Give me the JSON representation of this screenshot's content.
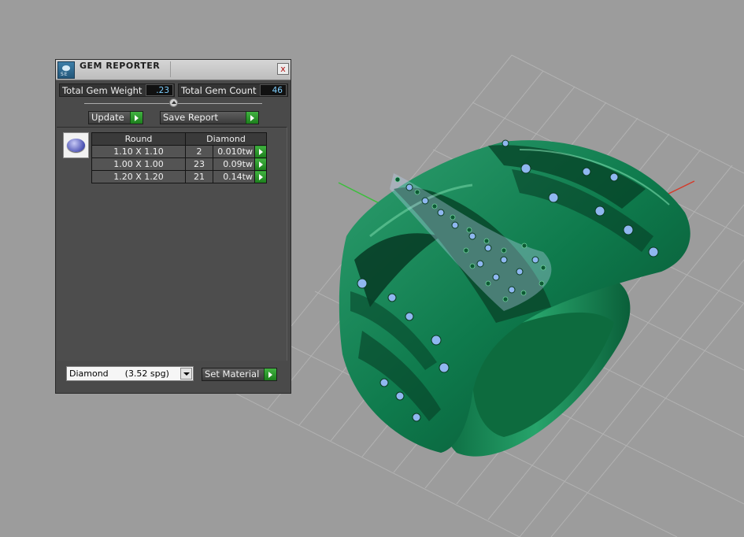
{
  "gem_reporter": {
    "title": "GEM REPORTER",
    "close_label": "x",
    "total_weight_label": "Total Gem Weight",
    "total_weight_value": ".23",
    "total_count_label": "Total Gem Count",
    "total_count_value": "46",
    "update_label": "Update",
    "save_report_label": "Save Report",
    "shape_header": "Round",
    "material_header": "Diamond",
    "rows": [
      {
        "size": "1.10 X 1.10",
        "count": "2",
        "weight": "0.010tw"
      },
      {
        "size": "1.00 X 1.00",
        "count": "23",
        "weight": "0.09tw"
      },
      {
        "size": "1.20 X 1.20",
        "count": "21",
        "weight": "0.14tw"
      }
    ],
    "material_select": "Diamond      (3.52 spg)",
    "set_material_label": "Set Material"
  },
  "viewport": {
    "background": "#9c9c9c",
    "grid_color": "#b4b4b4",
    "ring_color": "#0f7a4a",
    "gem_color": "#8fb7f0"
  }
}
